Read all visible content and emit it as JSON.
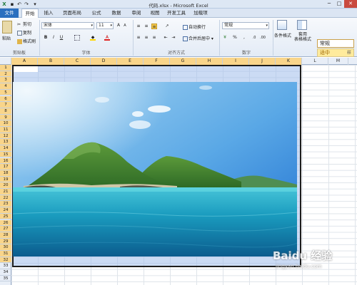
{
  "window": {
    "title": "代码.xlsx - Microsoft Excel",
    "minimize": "─",
    "maximize": "□",
    "close": "✕"
  },
  "ribbon_tabs": [
    "文件",
    "开始",
    "插入",
    "页面布局",
    "公式",
    "数据",
    "审阅",
    "视图",
    "开发工具",
    "加载项"
  ],
  "clipboard": {
    "paste": "粘贴",
    "cut": "剪切",
    "copy": "复制",
    "format_painter": "格式刷",
    "label": "剪贴板"
  },
  "font": {
    "name": "宋体",
    "size": "11",
    "bold": "B",
    "italic": "I",
    "underline": "U",
    "font_color": "A",
    "label": "字体"
  },
  "alignment": {
    "wrap_text": "自动换行",
    "merge_center": "合并后居中",
    "label": "对齐方式"
  },
  "number": {
    "format": "常规",
    "percent": "%",
    "comma": ",",
    "label": "数字"
  },
  "styles": {
    "conditional_format": "条件格式",
    "table_format": "套用\n表格格式",
    "normal": "常规",
    "neutral": "适中",
    "label": "样"
  },
  "columns": [
    "A",
    "B",
    "C",
    "D",
    "E",
    "F",
    "G",
    "H",
    "I",
    "J",
    "K",
    "L",
    "M"
  ],
  "rows": [
    "1",
    "2",
    "3",
    "4",
    "5",
    "6",
    "7",
    "8",
    "9",
    "10",
    "11",
    "12",
    "13",
    "14",
    "15",
    "16",
    "17",
    "18",
    "19",
    "20",
    "21",
    "22",
    "23",
    "24",
    "25",
    "26",
    "27",
    "28",
    "29",
    "30",
    "31",
    "32",
    "33",
    "34",
    "35"
  ],
  "watermark": {
    "main": "Baidu 经验",
    "sub": "jingyan.baidu.com"
  },
  "colors": {
    "file_tab": "#2a6fbf",
    "selection_header": "#f9d58a",
    "neutral_style": "#ffeb9c"
  }
}
